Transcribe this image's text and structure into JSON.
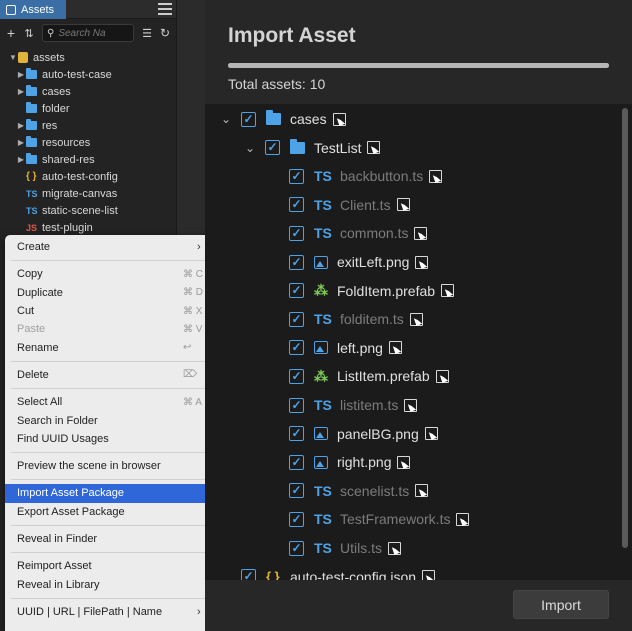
{
  "assets_panel": {
    "tab_label": "Assets",
    "search_placeholder": "Search Na",
    "tree": [
      {
        "label": "assets",
        "icon": "database-icon",
        "expanded": true
      },
      {
        "label": "auto-test-case",
        "icon": "folder-icon",
        "collapsed": true
      },
      {
        "label": "cases",
        "icon": "folder-icon",
        "collapsed": true
      },
      {
        "label": "folder",
        "icon": "folder-icon"
      },
      {
        "label": "res",
        "icon": "folder-icon",
        "collapsed": true
      },
      {
        "label": "resources",
        "icon": "folder-icon",
        "collapsed": true
      },
      {
        "label": "shared-res",
        "icon": "folder-icon",
        "collapsed": true
      },
      {
        "label": "auto-test-config",
        "icon": "json-icon"
      },
      {
        "label": "migrate-canvas",
        "icon": "ts-icon"
      },
      {
        "label": "static-scene-list",
        "icon": "ts-icon"
      },
      {
        "label": "test-plugin",
        "icon": "js-icon"
      }
    ]
  },
  "context_menu": {
    "create": "Create",
    "copy": "Copy",
    "copy_sc": "⌘ C",
    "duplicate": "Duplicate",
    "duplicate_sc": "⌘ D",
    "cut": "Cut",
    "cut_sc": "⌘ X",
    "paste": "Paste",
    "paste_sc": "⌘ V",
    "rename": "Rename",
    "rename_sc": "↩",
    "delete": "Delete",
    "delete_sc": "⌦",
    "select_all": "Select All",
    "select_all_sc": "⌘ A",
    "search_in_folder": "Search in Folder",
    "find_uuid_usages": "Find UUID Usages",
    "preview_scene": "Preview the scene in browser",
    "import_asset_package": "Import Asset Package",
    "export_asset_package": "Export Asset Package",
    "reveal_in_finder": "Reveal in Finder",
    "reimport_asset": "Reimport Asset",
    "reveal_in_library": "Reveal in Library",
    "uuid_url": "UUID | URL | FilePath | Name"
  },
  "import_dialog": {
    "title": "Import Asset",
    "progress": 1.0,
    "total_assets": "Total assets: 10",
    "import_button": "Import",
    "files": [
      {
        "name": "cases",
        "type": "folder",
        "checked": true,
        "dim": false
      },
      {
        "name": "TestList",
        "type": "folder",
        "checked": true,
        "dim": false
      },
      {
        "name": "backbutton.ts",
        "type": "ts",
        "checked": true,
        "dim": true
      },
      {
        "name": "Client.ts",
        "type": "ts",
        "checked": true,
        "dim": true
      },
      {
        "name": "common.ts",
        "type": "ts",
        "checked": true,
        "dim": true
      },
      {
        "name": "exitLeft.png",
        "type": "image",
        "checked": true,
        "dim": false
      },
      {
        "name": "FoldItem.prefab",
        "type": "prefab",
        "checked": true,
        "dim": false
      },
      {
        "name": "folditem.ts",
        "type": "ts",
        "checked": true,
        "dim": true
      },
      {
        "name": "left.png",
        "type": "image",
        "checked": true,
        "dim": false
      },
      {
        "name": "ListItem.prefab",
        "type": "prefab",
        "checked": true,
        "dim": false
      },
      {
        "name": "listitem.ts",
        "type": "ts",
        "checked": true,
        "dim": true
      },
      {
        "name": "panelBG.png",
        "type": "image",
        "checked": true,
        "dim": false
      },
      {
        "name": "right.png",
        "type": "image",
        "checked": true,
        "dim": false
      },
      {
        "name": "scenelist.ts",
        "type": "ts",
        "checked": true,
        "dim": true
      },
      {
        "name": "TestFramework.ts",
        "type": "ts",
        "checked": true,
        "dim": true
      },
      {
        "name": "Utils.ts",
        "type": "ts",
        "checked": true,
        "dim": true
      },
      {
        "name": "auto-test-config.json",
        "type": "json",
        "checked": true,
        "dim": false
      }
    ]
  }
}
